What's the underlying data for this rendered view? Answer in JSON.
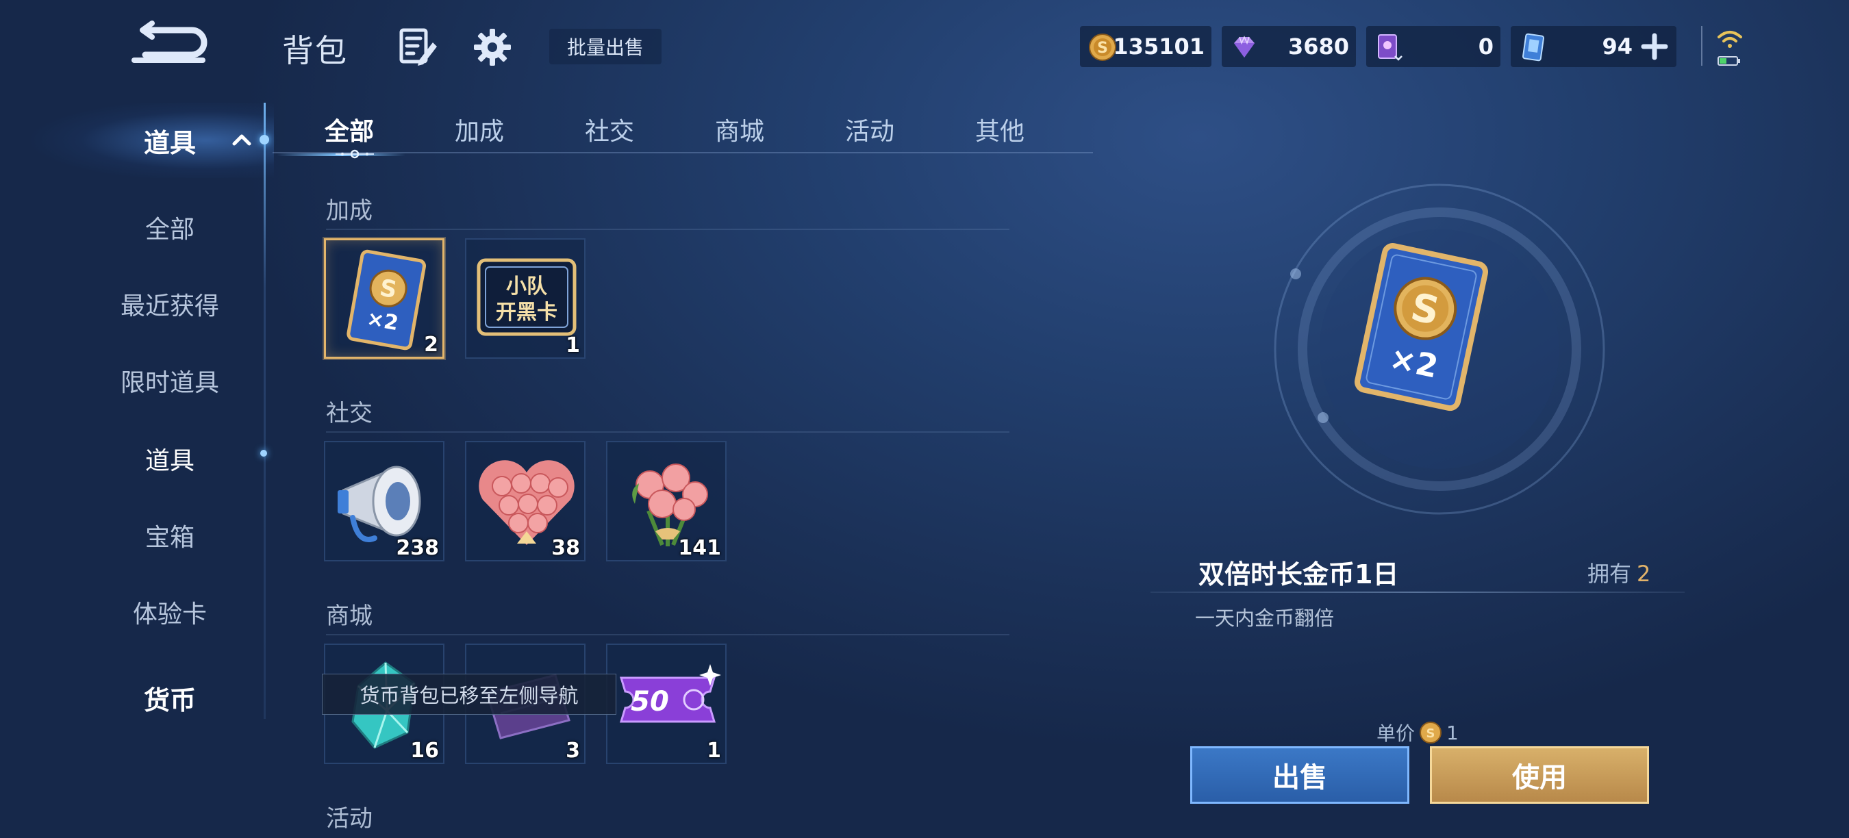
{
  "header": {
    "title": "背包",
    "bulk_sell_label": "批量出售"
  },
  "currencies": {
    "gold": "135101",
    "gems": "3680",
    "cards": "0",
    "tickets": "94"
  },
  "nav": {
    "group1": "道具",
    "items": [
      "全部",
      "最近获得",
      "限时道具",
      "道具",
      "宝箱",
      "体验卡"
    ],
    "group2": "货币"
  },
  "tabs": [
    "全部",
    "加成",
    "社交",
    "商城",
    "活动",
    "其他"
  ],
  "sections": [
    {
      "label": "加成",
      "items": [
        {
          "icon": "double-gold-card-icon",
          "count": "2",
          "selected": true
        },
        {
          "icon": "squad-card-icon",
          "count": "1",
          "card_text_1": "小队",
          "card_text_2": "开黑卡"
        }
      ]
    },
    {
      "label": "社交",
      "items": [
        {
          "icon": "megaphone-icon",
          "count": "238"
        },
        {
          "icon": "heart-roses-icon",
          "count": "38"
        },
        {
          "icon": "rose-bouquet-icon",
          "count": "141"
        }
      ]
    },
    {
      "label": "商城",
      "items": [
        {
          "icon": "crystal-icon",
          "count": "16"
        },
        {
          "icon": "purple-scroll-icon",
          "count": "3"
        },
        {
          "icon": "coupon-50-icon",
          "count": "1",
          "coupon_value": "50"
        }
      ]
    },
    {
      "label": "活动",
      "items": []
    }
  ],
  "tooltip": "货币背包已移至左侧导航",
  "detail": {
    "name": "双倍时长金币1日",
    "own_label": "拥有",
    "own_count": "2",
    "description": "一天内金币翻倍",
    "price_label": "单价",
    "price": "1",
    "card_multiplier": "×2",
    "sell_label": "出售",
    "use_label": "使用"
  },
  "colors": {
    "accent_gold": "#e2b36a",
    "sell_blue": "#3b78c6",
    "use_gold": "#d8b06a"
  }
}
